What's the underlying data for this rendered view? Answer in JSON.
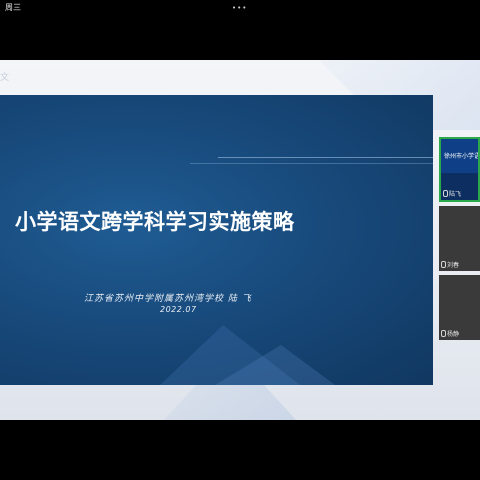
{
  "status_bar": {
    "day": "周三",
    "menu_dots": "•••"
  },
  "background": {
    "ghost_char": "文"
  },
  "slide": {
    "title": "小学语文跨学科学习实施策略",
    "author": "江苏省苏州中学附属苏州湾学校   陆 飞",
    "date": "2022.07"
  },
  "participants": [
    {
      "thumbnail_title": "徐州市小学语",
      "name": "陆飞",
      "active": true
    },
    {
      "name": "刘春",
      "active": false
    },
    {
      "name": "杨静",
      "active": false
    }
  ],
  "colors": {
    "slide_blue": "#184a7c",
    "active_border": "#2aa84a"
  }
}
